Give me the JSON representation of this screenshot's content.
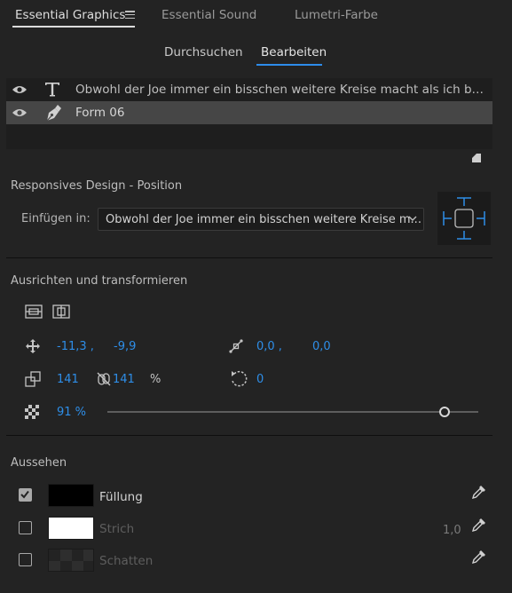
{
  "panel_tabs": {
    "essential_graphics": "Essential Graphics",
    "essential_sound": "Essential Sound",
    "lumetri": "Lumetri-Farbe"
  },
  "subtabs": {
    "browse": "Durchsuchen",
    "edit": "Bearbeiten"
  },
  "layers": [
    {
      "name": "Obwohl der Joe immer ein bisschen weitere Kreise macht als ich beim Kur...",
      "type": "text",
      "selected": false
    },
    {
      "name": "Form 06",
      "type": "shape",
      "selected": true
    }
  ],
  "responsive": {
    "title": "Responsives Design - Position",
    "pin_label": "Einfügen in:",
    "pin_value": "Obwohl der Joe immer ein bisschen weitere Kreise m..."
  },
  "align": {
    "title": "Ausrichten und transformieren",
    "position_x": "-11,3 ,",
    "position_y": "-9,9",
    "anchor_x": "0,0 ,",
    "anchor_y": "0,0",
    "scale_w": "141",
    "scale_h": "141",
    "scale_unit": "%",
    "rotation": "0",
    "opacity": "91 %",
    "opacity_value": 0.91
  },
  "appearance": {
    "title": "Aussehen",
    "fill": {
      "label": "Füllung",
      "checked": true,
      "color": "#000000"
    },
    "stroke": {
      "label": "Strich",
      "checked": false,
      "color": "#ffffff",
      "width": "1,0"
    },
    "shadow": {
      "label": "Schatten",
      "checked": false
    }
  },
  "colors": {
    "accent": "#2e8ee8",
    "background": "#232323",
    "selected_row": "#464646"
  }
}
